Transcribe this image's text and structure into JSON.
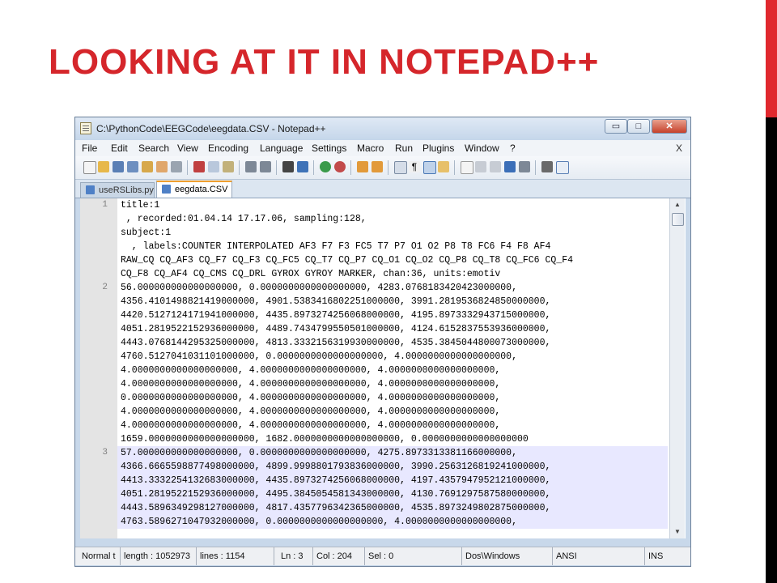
{
  "slide": {
    "title": "LOOKING AT IT IN NOTEPAD++",
    "accent_color": "#d5262b"
  },
  "window": {
    "title": "C:\\PythonCode\\EEGCode\\eegdata.CSV - Notepad++",
    "controls": {
      "minimize": "▭",
      "maximize": "□",
      "close": "✕"
    }
  },
  "menu": {
    "items": [
      "File",
      "Edit",
      "Search",
      "View",
      "Encoding",
      "Language",
      "Settings",
      "Macro",
      "Run",
      "Plugins",
      "Window",
      "?"
    ],
    "close_doc": "X"
  },
  "toolbar": {
    "icons": [
      "new-file-icon",
      "open-file-icon",
      "save-icon",
      "save-all-icon",
      "close-icon",
      "close-all-icon",
      "print-icon",
      "cut-icon",
      "copy-icon",
      "paste-icon",
      "undo-icon",
      "redo-icon",
      "find-icon",
      "replace-icon",
      "zoom-in-icon",
      "zoom-out-icon",
      "sync-v-icon",
      "sync-h-icon",
      "word-wrap-icon",
      "show-all-chars-icon",
      "indent-guide-icon",
      "user-lang-icon",
      "record-macro-icon",
      "stop-macro-icon",
      "play-macro-icon",
      "run-macro-multiple-icon",
      "save-macro-icon",
      "run-icon",
      "spellcheck-icon"
    ]
  },
  "tabs": [
    {
      "label": "useRSLibs.py",
      "active": false
    },
    {
      "label": "eegdata.CSV",
      "active": true
    }
  ],
  "editor": {
    "lines": [
      {
        "num": "1",
        "text": "title:1"
      },
      {
        "num": "",
        "text": " , recorded:01.04.14 17.17.06, sampling:128,"
      },
      {
        "num": "",
        "text": "subject:1"
      },
      {
        "num": "",
        "text": "  , labels:COUNTER INTERPOLATED AF3 F7 F3 FC5 T7 P7 O1 O2 P8 T8 FC6 F4 F8 AF4"
      },
      {
        "num": "",
        "text": "RAW_CQ CQ_AF3 CQ_F7 CQ_F3 CQ_FC5 CQ_T7 CQ_P7 CQ_O1 CQ_O2 CQ_P8 CQ_T8 CQ_FC6 CQ_F4"
      },
      {
        "num": "",
        "text": "CQ_F8 CQ_AF4 CQ_CMS CQ_DRL GYROX GYROY MARKER, chan:36, units:emotiv"
      },
      {
        "num": "2",
        "text": "56.000000000000000000, 0.0000000000000000000, 4283.0768183420423000000,"
      },
      {
        "num": "",
        "text": "4356.4101498821419000000, 4901.5383416802251000000, 3991.2819536824850000000,"
      },
      {
        "num": "",
        "text": "4420.5127124171941000000, 4435.8973274256068000000, 4195.8973332943715000000,"
      },
      {
        "num": "",
        "text": "4051.2819522152936000000, 4489.7434799550501000000, 4124.6152837553936000000,"
      },
      {
        "num": "",
        "text": "4443.0768144295325000000, 4813.3332156319930000000, 4535.3845044800073000000,"
      },
      {
        "num": "",
        "text": "4760.5127041031101000000, 0.0000000000000000000, 4.0000000000000000000,"
      },
      {
        "num": "",
        "text": "4.0000000000000000000, 4.0000000000000000000, 4.0000000000000000000,"
      },
      {
        "num": "",
        "text": "4.0000000000000000000, 4.0000000000000000000, 4.0000000000000000000,"
      },
      {
        "num": "",
        "text": "0.0000000000000000000, 4.0000000000000000000, 4.0000000000000000000,"
      },
      {
        "num": "",
        "text": "4.0000000000000000000, 4.0000000000000000000, 4.0000000000000000000,"
      },
      {
        "num": "",
        "text": "4.0000000000000000000, 4.0000000000000000000, 4.0000000000000000000,"
      },
      {
        "num": "",
        "text": "1659.0000000000000000000, 1682.0000000000000000000, 0.0000000000000000000"
      },
      {
        "num": "3",
        "text": "57.000000000000000000, 0.0000000000000000000, 4275.8973313381166000000,"
      },
      {
        "num": "",
        "text": "4366.6665598877498000000, 4899.9998801793836000000, 3990.2563126819241000000,"
      },
      {
        "num": "",
        "text": "4413.3332254132683000000, 4435.8973274256068000000, 4197.4357947952121000000,"
      },
      {
        "num": "",
        "text": "4051.2819522152936000000, 4495.3845054581343000000, 4130.7691297587580000000,"
      },
      {
        "num": "",
        "text": "4443.5896349298127000000, 4817.4357796342365000000, 4535.8973249802875000000,"
      },
      {
        "num": "",
        "text": "4763.5896271047932000000, 0.0000000000000000000, 4.0000000000000000000,"
      }
    ],
    "highlight_color": "#e8e8ff"
  },
  "status": {
    "doc_type": "Normal t",
    "length": "length : 1052973",
    "lines": "lines : 1154",
    "ln": "Ln : 3",
    "col": "Col : 204",
    "sel": "Sel : 0",
    "eol": "Dos\\Windows",
    "encoding": "ANSI",
    "mode": "INS"
  }
}
